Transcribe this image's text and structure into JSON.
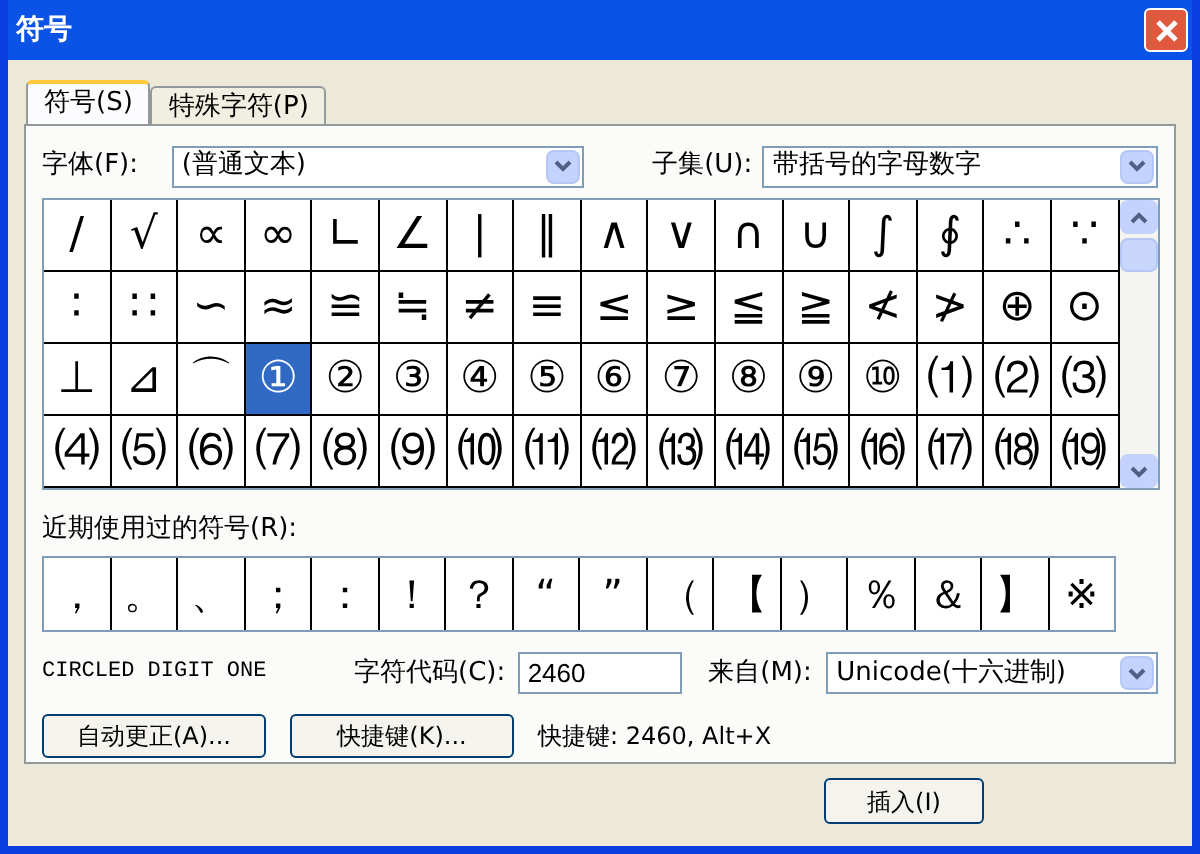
{
  "window": {
    "title": "符号"
  },
  "tabs": [
    {
      "label": "符号(S)",
      "selected": true
    },
    {
      "label": "特殊字符(P)",
      "selected": false
    }
  ],
  "font": {
    "label": "字体(F):",
    "value": "(普通文本)"
  },
  "subset": {
    "label": "子集(U):",
    "value": "带括号的字母数字"
  },
  "symbols": [
    {
      "char": "/",
      "selected": false
    },
    {
      "char": "√",
      "selected": false
    },
    {
      "char": "∝",
      "selected": false
    },
    {
      "char": "∞",
      "selected": false
    },
    {
      "char": "∟",
      "selected": false
    },
    {
      "char": "∠",
      "selected": false
    },
    {
      "char": "∣",
      "selected": false
    },
    {
      "char": "∥",
      "selected": false
    },
    {
      "char": "∧",
      "selected": false
    },
    {
      "char": "∨",
      "selected": false
    },
    {
      "char": "∩",
      "selected": false
    },
    {
      "char": "∪",
      "selected": false
    },
    {
      "char": "∫",
      "selected": false
    },
    {
      "char": "∮",
      "selected": false
    },
    {
      "char": "∴",
      "selected": false
    },
    {
      "char": "∵",
      "selected": false
    },
    {
      "char": "∶",
      "selected": false
    },
    {
      "char": "∷",
      "selected": false
    },
    {
      "char": "∽",
      "selected": false
    },
    {
      "char": "≈",
      "selected": false
    },
    {
      "char": "≌",
      "selected": false
    },
    {
      "char": "≒",
      "selected": false
    },
    {
      "char": "≠",
      "selected": false
    },
    {
      "char": "≡",
      "selected": false
    },
    {
      "char": "≤",
      "selected": false
    },
    {
      "char": "≥",
      "selected": false
    },
    {
      "char": "≦",
      "selected": false
    },
    {
      "char": "≧",
      "selected": false
    },
    {
      "char": "≮",
      "selected": false
    },
    {
      "char": "≯",
      "selected": false
    },
    {
      "char": "⊕",
      "selected": false
    },
    {
      "char": "⊙",
      "selected": false
    },
    {
      "char": "⊥",
      "selected": false
    },
    {
      "char": "⊿",
      "selected": false
    },
    {
      "char": "⌒",
      "selected": false
    },
    {
      "char": "①",
      "selected": true
    },
    {
      "char": "②",
      "selected": false
    },
    {
      "char": "③",
      "selected": false
    },
    {
      "char": "④",
      "selected": false
    },
    {
      "char": "⑤",
      "selected": false
    },
    {
      "char": "⑥",
      "selected": false
    },
    {
      "char": "⑦",
      "selected": false
    },
    {
      "char": "⑧",
      "selected": false
    },
    {
      "char": "⑨",
      "selected": false
    },
    {
      "char": "⑩",
      "selected": false
    },
    {
      "char": "⑴",
      "selected": false
    },
    {
      "char": "⑵",
      "selected": false
    },
    {
      "char": "⑶",
      "selected": false
    },
    {
      "char": "⑷",
      "selected": false
    },
    {
      "char": "⑸",
      "selected": false
    },
    {
      "char": "⑹",
      "selected": false
    },
    {
      "char": "⑺",
      "selected": false
    },
    {
      "char": "⑻",
      "selected": false
    },
    {
      "char": "⑼",
      "selected": false
    },
    {
      "char": "⑽",
      "selected": false
    },
    {
      "char": "⑾",
      "selected": false
    },
    {
      "char": "⑿",
      "selected": false
    },
    {
      "char": "⒀",
      "selected": false
    },
    {
      "char": "⒁",
      "selected": false
    },
    {
      "char": "⒂",
      "selected": false
    },
    {
      "char": "⒃",
      "selected": false
    },
    {
      "char": "⒄",
      "selected": false
    },
    {
      "char": "⒅",
      "selected": false
    },
    {
      "char": "⒆",
      "selected": false
    }
  ],
  "recent": {
    "label": "近期使用过的符号(R):",
    "symbols": [
      "，",
      "。",
      "、",
      "；",
      "：",
      "！",
      "？",
      "“",
      "”",
      "（",
      "【",
      "）",
      "％",
      "＆",
      "】",
      "※"
    ]
  },
  "char_name": "CIRCLED DIGIT ONE",
  "char_code": {
    "label": "字符代码(C):",
    "value": "2460"
  },
  "from": {
    "label": "来自(M):",
    "value": "Unicode(十六进制)"
  },
  "buttons": [
    "自动更正(A)...",
    "快捷键(K)..."
  ],
  "shortcut": "快捷键: 2460, Alt+X",
  "insert_button": "插入(I)"
}
